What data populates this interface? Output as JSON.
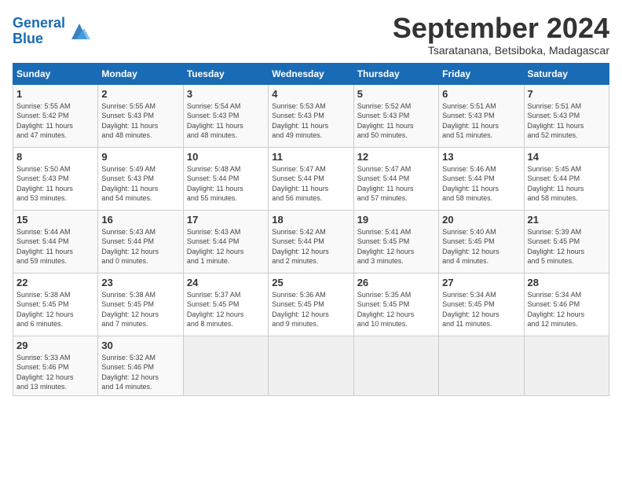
{
  "header": {
    "logo_general": "General",
    "logo_blue": "Blue",
    "month_title": "September 2024",
    "location": "Tsaratanana, Betsiboka, Madagascar"
  },
  "weekdays": [
    "Sunday",
    "Monday",
    "Tuesday",
    "Wednesday",
    "Thursday",
    "Friday",
    "Saturday"
  ],
  "weeks": [
    [
      {
        "day": "1",
        "info": "Sunrise: 5:55 AM\nSunset: 5:42 PM\nDaylight: 11 hours\nand 47 minutes."
      },
      {
        "day": "2",
        "info": "Sunrise: 5:55 AM\nSunset: 5:43 PM\nDaylight: 11 hours\nand 48 minutes."
      },
      {
        "day": "3",
        "info": "Sunrise: 5:54 AM\nSunset: 5:43 PM\nDaylight: 11 hours\nand 48 minutes."
      },
      {
        "day": "4",
        "info": "Sunrise: 5:53 AM\nSunset: 5:43 PM\nDaylight: 11 hours\nand 49 minutes."
      },
      {
        "day": "5",
        "info": "Sunrise: 5:52 AM\nSunset: 5:43 PM\nDaylight: 11 hours\nand 50 minutes."
      },
      {
        "day": "6",
        "info": "Sunrise: 5:51 AM\nSunset: 5:43 PM\nDaylight: 11 hours\nand 51 minutes."
      },
      {
        "day": "7",
        "info": "Sunrise: 5:51 AM\nSunset: 5:43 PM\nDaylight: 11 hours\nand 52 minutes."
      }
    ],
    [
      {
        "day": "8",
        "info": "Sunrise: 5:50 AM\nSunset: 5:43 PM\nDaylight: 11 hours\nand 53 minutes."
      },
      {
        "day": "9",
        "info": "Sunrise: 5:49 AM\nSunset: 5:43 PM\nDaylight: 11 hours\nand 54 minutes."
      },
      {
        "day": "10",
        "info": "Sunrise: 5:48 AM\nSunset: 5:44 PM\nDaylight: 11 hours\nand 55 minutes."
      },
      {
        "day": "11",
        "info": "Sunrise: 5:47 AM\nSunset: 5:44 PM\nDaylight: 11 hours\nand 56 minutes."
      },
      {
        "day": "12",
        "info": "Sunrise: 5:47 AM\nSunset: 5:44 PM\nDaylight: 11 hours\nand 57 minutes."
      },
      {
        "day": "13",
        "info": "Sunrise: 5:46 AM\nSunset: 5:44 PM\nDaylight: 11 hours\nand 58 minutes."
      },
      {
        "day": "14",
        "info": "Sunrise: 5:45 AM\nSunset: 5:44 PM\nDaylight: 11 hours\nand 58 minutes."
      }
    ],
    [
      {
        "day": "15",
        "info": "Sunrise: 5:44 AM\nSunset: 5:44 PM\nDaylight: 11 hours\nand 59 minutes."
      },
      {
        "day": "16",
        "info": "Sunrise: 5:43 AM\nSunset: 5:44 PM\nDaylight: 12 hours\nand 0 minutes."
      },
      {
        "day": "17",
        "info": "Sunrise: 5:43 AM\nSunset: 5:44 PM\nDaylight: 12 hours\nand 1 minute."
      },
      {
        "day": "18",
        "info": "Sunrise: 5:42 AM\nSunset: 5:44 PM\nDaylight: 12 hours\nand 2 minutes."
      },
      {
        "day": "19",
        "info": "Sunrise: 5:41 AM\nSunset: 5:45 PM\nDaylight: 12 hours\nand 3 minutes."
      },
      {
        "day": "20",
        "info": "Sunrise: 5:40 AM\nSunset: 5:45 PM\nDaylight: 12 hours\nand 4 minutes."
      },
      {
        "day": "21",
        "info": "Sunrise: 5:39 AM\nSunset: 5:45 PM\nDaylight: 12 hours\nand 5 minutes."
      }
    ],
    [
      {
        "day": "22",
        "info": "Sunrise: 5:38 AM\nSunset: 5:45 PM\nDaylight: 12 hours\nand 6 minutes."
      },
      {
        "day": "23",
        "info": "Sunrise: 5:38 AM\nSunset: 5:45 PM\nDaylight: 12 hours\nand 7 minutes."
      },
      {
        "day": "24",
        "info": "Sunrise: 5:37 AM\nSunset: 5:45 PM\nDaylight: 12 hours\nand 8 minutes."
      },
      {
        "day": "25",
        "info": "Sunrise: 5:36 AM\nSunset: 5:45 PM\nDaylight: 12 hours\nand 9 minutes."
      },
      {
        "day": "26",
        "info": "Sunrise: 5:35 AM\nSunset: 5:45 PM\nDaylight: 12 hours\nand 10 minutes."
      },
      {
        "day": "27",
        "info": "Sunrise: 5:34 AM\nSunset: 5:45 PM\nDaylight: 12 hours\nand 11 minutes."
      },
      {
        "day": "28",
        "info": "Sunrise: 5:34 AM\nSunset: 5:46 PM\nDaylight: 12 hours\nand 12 minutes."
      }
    ],
    [
      {
        "day": "29",
        "info": "Sunrise: 5:33 AM\nSunset: 5:46 PM\nDaylight: 12 hours\nand 13 minutes."
      },
      {
        "day": "30",
        "info": "Sunrise: 5:32 AM\nSunset: 5:46 PM\nDaylight: 12 hours\nand 14 minutes."
      },
      {
        "day": "",
        "info": ""
      },
      {
        "day": "",
        "info": ""
      },
      {
        "day": "",
        "info": ""
      },
      {
        "day": "",
        "info": ""
      },
      {
        "day": "",
        "info": ""
      }
    ]
  ]
}
